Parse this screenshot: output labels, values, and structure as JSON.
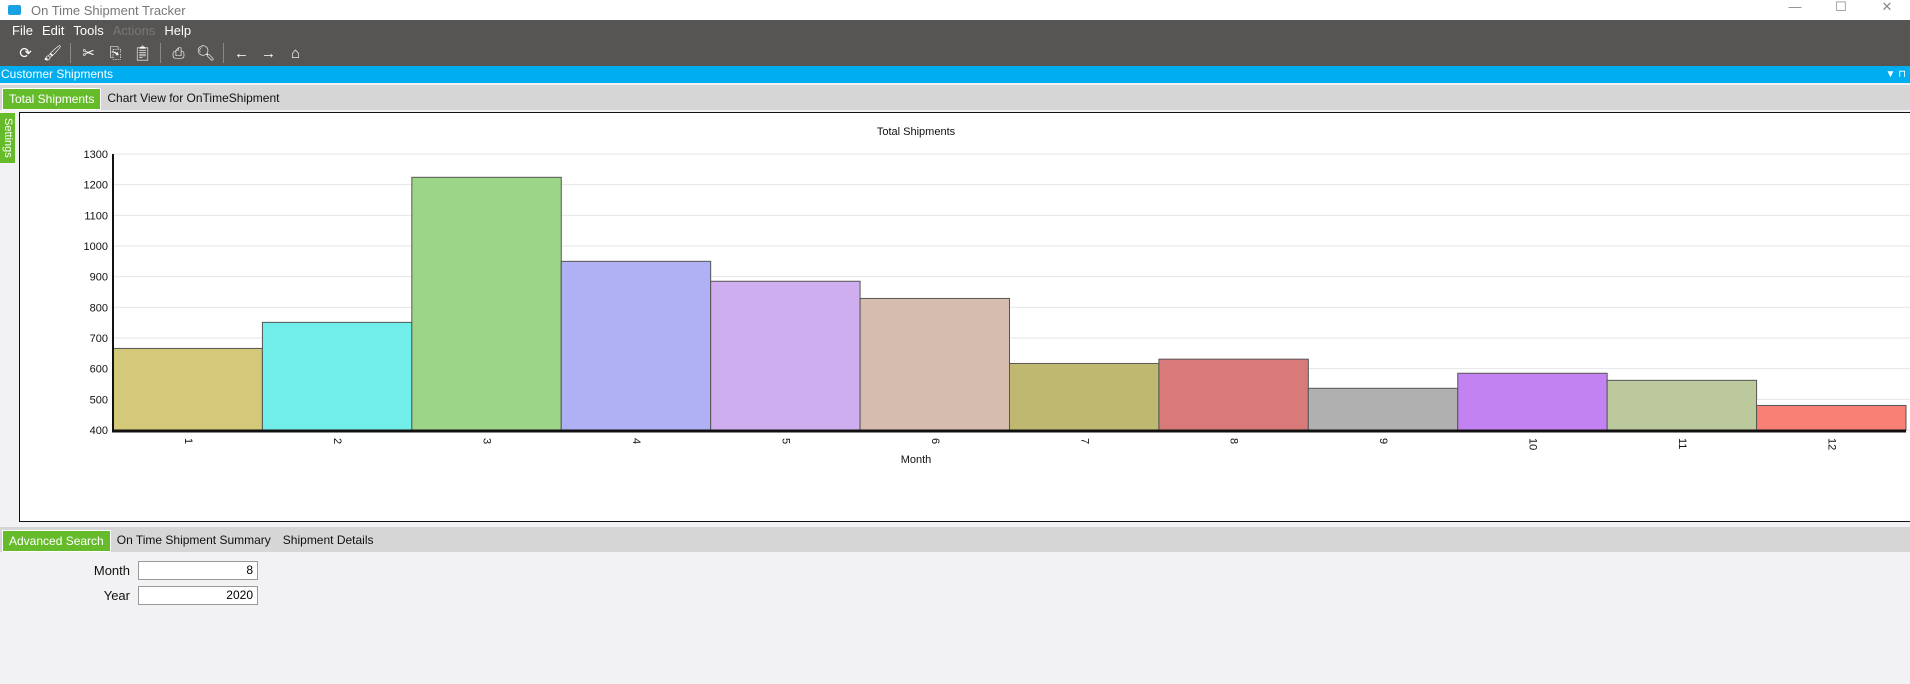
{
  "window": {
    "title": "On Time Shipment Tracker"
  },
  "menu": [
    "File",
    "Edit",
    "Tools",
    "Actions",
    "Help"
  ],
  "toolbar": [
    "refresh-icon",
    "clear-icon",
    "cut-icon",
    "copy-icon",
    "paste-icon",
    "print-icon",
    "print-preview-icon",
    "back-icon",
    "forward-icon",
    "home-icon"
  ],
  "panel": {
    "title": "Customer Shipments"
  },
  "top_tabs": [
    "Total Shipments",
    "Chart View for OnTimeShipment"
  ],
  "settings_label": "Settings",
  "chart_data": {
    "type": "bar",
    "title": "Total Shipments",
    "xlabel": "Month",
    "ylabel": "",
    "categories": [
      "1",
      "2",
      "3",
      "4",
      "5",
      "6",
      "7",
      "8",
      "9",
      "10",
      "11",
      "12"
    ],
    "values": [
      666,
      751,
      1224,
      950,
      885,
      829,
      617,
      631,
      536,
      585,
      562,
      480
    ],
    "colors": [
      "#d4c87a",
      "#72eeea",
      "#9dd588",
      "#b0b0f5",
      "#cfaeef",
      "#d6bcae",
      "#bfb870",
      "#d87a7a",
      "#b0b0b0",
      "#c282f2",
      "#bcc99c",
      "#f88074"
    ],
    "ylim": [
      400,
      1300
    ],
    "yticks": [
      "400",
      "500",
      "600",
      "700",
      "800",
      "900",
      "1000",
      "1100",
      "1200",
      "1300"
    ],
    "grid": true
  },
  "bottom_tabs": [
    "Advanced Search",
    "On Time Shipment Summary",
    "Shipment Details"
  ],
  "form": {
    "month_label": "Month",
    "month_value": "8",
    "year_label": "Year",
    "year_value": "2020"
  }
}
